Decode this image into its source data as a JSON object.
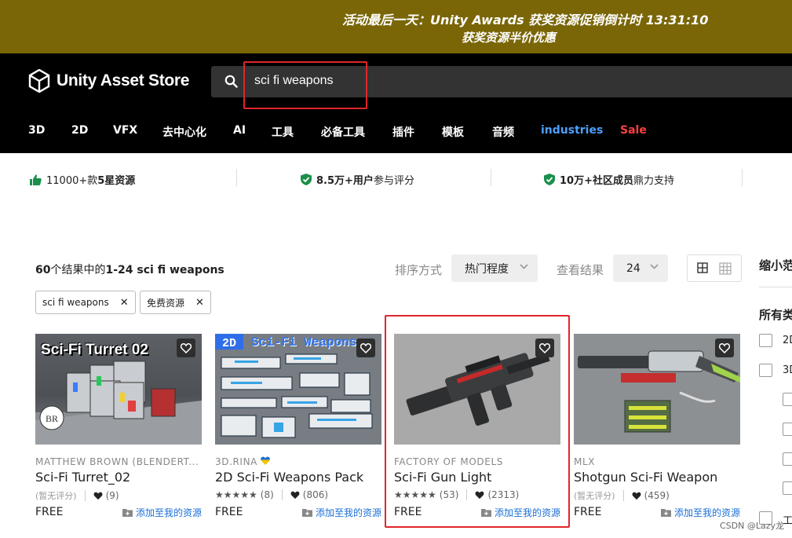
{
  "promo": {
    "line1": "活动最后一天：Unity Awards 获奖资源促销倒计时 13:31:10",
    "line2": "获奖资源半价优惠"
  },
  "header": {
    "logo_text": "Unity Asset Store",
    "search_value": "sci fi weapons",
    "search_icon": "search-icon",
    "nav": [
      "3D",
      "2D",
      "VFX",
      "去中心化",
      "AI",
      "工具",
      "必备工具",
      "插件",
      "模板",
      "音频",
      "industries",
      "Sale"
    ],
    "colors": {
      "industries": "#4d9fff",
      "sale": "#ff4040",
      "promo_bg": "#7a6607",
      "highlight": "#e0262b"
    }
  },
  "trust": [
    {
      "icon": "thumbs-up-icon",
      "bold": "11000+",
      "rest": "款",
      "bold2": "5星资源"
    },
    {
      "icon": "check-shield-icon",
      "bold": "8.5万+用户",
      "rest": "参与评分"
    },
    {
      "icon": "check-shield-icon",
      "bold": "10万+社区成员",
      "rest": "鼎力支持"
    }
  ],
  "results": {
    "summary_prefix": "60",
    "summary_mid": "个结果中的",
    "summary_range": "1-24 sci fi weapons",
    "sort_label": "排序方式",
    "sort_value": "热门程度",
    "view_label": "查看结果",
    "view_value": "24",
    "chips": [
      "sci fi weapons",
      "免费资源"
    ]
  },
  "products": [
    {
      "publisher": "MATTHEW BROWN (BLENDERT...",
      "title": "Sci-Fi Turret_02",
      "rating_text": "(暂无评分)",
      "rating_count": "",
      "favorites": "(9)",
      "price": "FREE",
      "add_label": "添加至我的资源",
      "thumb_caption": "Sci-Fi Turret 02"
    },
    {
      "publisher": "3D.RINA",
      "title": "2D Sci-Fi Weapons Pack",
      "rating_text": "★★★★★",
      "rating_count": "(8)",
      "favorites": "(806)",
      "price": "FREE",
      "add_label": "添加至我的资源",
      "thumb_caption": "2D Sci-Fi Weapons"
    },
    {
      "publisher": "FACTORY OF MODELS",
      "title": "Sci-Fi Gun Light",
      "rating_text": "★★★★★",
      "rating_count": "(53)",
      "favorites": "(2313)",
      "price": "FREE",
      "add_label": "添加至我的资源",
      "thumb_caption": ""
    },
    {
      "publisher": "MLX",
      "title": "Shotgun Sci-Fi Weapon",
      "rating_text": "(暂无评分)",
      "rating_count": "",
      "favorites": "(459)",
      "price": "FREE",
      "add_label": "添加至我的资源",
      "thumb_caption": ""
    }
  ],
  "sidebar": {
    "title": "缩小范",
    "section": "所有类",
    "items": [
      "2D",
      "3D",
      "",
      "",
      "",
      "",
      "工"
    ]
  },
  "watermark": "CSDN @Lazy龙"
}
